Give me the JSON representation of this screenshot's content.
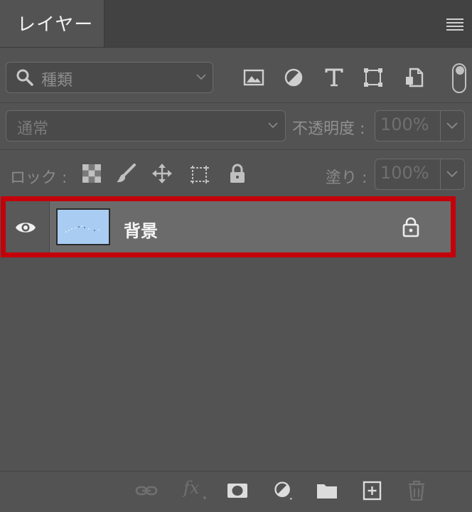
{
  "panel": {
    "tab_title": "レイヤー",
    "menu_icon": "panel-menu-icon"
  },
  "filter": {
    "placeholder": "種類",
    "icons": [
      "image-filter-icon",
      "adjustment-filter-icon",
      "type-filter-icon",
      "shape-filter-icon",
      "smart-object-filter-icon"
    ],
    "toggle_state": "off"
  },
  "blend": {
    "mode": "通常",
    "opacity_label": "不透明度 :",
    "opacity_value": "100%"
  },
  "lock": {
    "label": "ロック :",
    "icons": [
      "lock-transparent-pixels-icon",
      "lock-image-pixels-icon",
      "lock-position-icon",
      "lock-artboard-icon",
      "lock-all-icon"
    ],
    "fill_label": "塗り :",
    "fill_value": "100%"
  },
  "layers": [
    {
      "name": "背景",
      "visible": true,
      "locked": true,
      "selected": true,
      "highlight_color": "#c4000a"
    }
  ],
  "bottom_icons": [
    "link-layers-icon",
    "fx-icon",
    "layer-mask-icon",
    "adjustment-layer-icon",
    "folder-icon",
    "new-layer-icon",
    "trash-icon"
  ],
  "bottom": {
    "fx_label": "fx"
  },
  "colors": {
    "panel_bg": "#535353",
    "tab_bg": "#424242",
    "selected_row": "#6b6b6b",
    "highlight": "#c4000a",
    "thumb": "#a9cdf2"
  }
}
